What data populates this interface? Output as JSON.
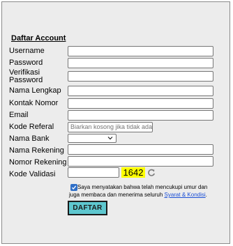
{
  "form": {
    "title": "Daftar Account",
    "fields": [
      {
        "label": "Username",
        "value": ""
      },
      {
        "label": "Password",
        "value": ""
      },
      {
        "label": "Verifikasi Password",
        "value": ""
      },
      {
        "label": "Nama Lengkap",
        "value": ""
      },
      {
        "label": "Kontak Nomor",
        "value": ""
      },
      {
        "label": "Email",
        "value": ""
      },
      {
        "label": "Kode Referal",
        "placeholder": "Biarkan kosong jika tidak ada"
      },
      {
        "label": "Nama Bank",
        "selected": ""
      },
      {
        "label": "Nama Rekening",
        "value": ""
      },
      {
        "label": "Nomor Rekening",
        "value": ""
      },
      {
        "label": "Kode Validasi",
        "value": ""
      }
    ],
    "captcha_code": "1642",
    "refresh_icon": "refresh-icon",
    "agreement": {
      "checked": true,
      "text": "Saya menyatakan bahwa telah mencukupi umur dan juga membaca dan menerima seluruh",
      "link": "Syarat & Kondisi",
      "suffix": "."
    },
    "submit_label": "DAFTAR"
  },
  "colors": {
    "panel_bg": "#ececec",
    "captcha_bg": "#ffff00",
    "button_bg": "#5ec7cf",
    "checkbox": "#2f6fc7",
    "link": "#1a4fd6"
  }
}
